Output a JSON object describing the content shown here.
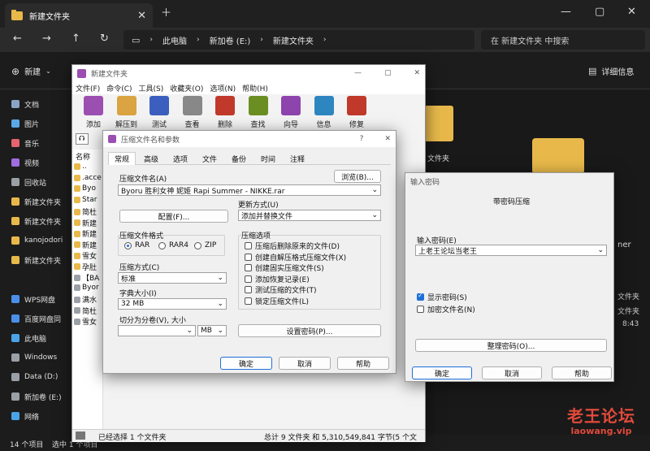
{
  "explorer": {
    "tab_title": "新建文件夹",
    "breadcrumb": [
      "此电脑",
      "新加卷 (E:)",
      "新建文件夹"
    ],
    "search_placeholder": "在 新建文件夹 中搜索",
    "new_label": "新建",
    "details_label": "详细信息",
    "sidebar": [
      {
        "label": "文档",
        "color": "#8aa4c8"
      },
      {
        "label": "图片",
        "color": "#5aa9e6"
      },
      {
        "label": "音乐",
        "color": "#e5646e"
      },
      {
        "label": "视频",
        "color": "#a06de0"
      },
      {
        "label": "回收站",
        "color": "#9aa0a6"
      },
      {
        "label": "新建文件夹",
        "color": "#e8b94a"
      },
      {
        "label": "新建文件夹",
        "color": "#e8b94a"
      },
      {
        "label": "kanojodori",
        "color": "#e8b94a"
      },
      {
        "label": "新建文件夹",
        "color": "#e8b94a"
      },
      {
        "label": "WPS网盘",
        "color": "#4a8fe8"
      },
      {
        "label": "百度网盘同",
        "color": "#4a8fe8"
      },
      {
        "label": "此电脑",
        "color": "#4aa3e8"
      },
      {
        "label": "Windows",
        "color": "#9aa0a6"
      },
      {
        "label": "Data (D:)",
        "color": "#9aa0a6"
      },
      {
        "label": "新加卷 (E:)",
        "color": "#9aa0a6"
      },
      {
        "label": "网络",
        "color": "#4aa3e8"
      }
    ],
    "right_texts": [
      "文件夹",
      "ner",
      "文件夹",
      "文件夹",
      "8:43"
    ],
    "status_left": "14 个项目",
    "status_mid": "选中 1 个项目"
  },
  "winrar": {
    "title": "新建文件夹",
    "menu": [
      "文件(F)",
      "命令(C)",
      "工具(S)",
      "收藏夹(O)",
      "选项(N)",
      "帮助(H)"
    ],
    "toolbar": [
      {
        "label": "添加",
        "color": "#9b4fb0"
      },
      {
        "label": "解压到",
        "color": "#d9a441"
      },
      {
        "label": "测试",
        "color": "#3c5fbf"
      },
      {
        "label": "查看",
        "color": "#888888"
      },
      {
        "label": "删除",
        "color": "#c0392b"
      },
      {
        "label": "查找",
        "color": "#6b8e23"
      },
      {
        "label": "向导",
        "color": "#8e44ad"
      },
      {
        "label": "信息",
        "color": "#2e86c1"
      },
      {
        "label": "修复",
        "color": "#c0392b"
      }
    ],
    "name_header": "名称",
    "files": [
      "..",
      ".acce",
      "Byo",
      "Star",
      "简杜",
      "新建",
      "新建",
      "新建",
      "雪女",
      "孕肚",
      "【BA",
      "Byor",
      "满水",
      "简杜",
      "雪女"
    ],
    "status": "已经选择 1 个文件夹",
    "status_total": "总计 9 文件夹 和 5,310,549,841 字节(5 个文"
  },
  "archive_dialog": {
    "title": "压缩文件名和参数",
    "question": "?",
    "tabs": [
      "常规",
      "高级",
      "选项",
      "文件",
      "备份",
      "时间",
      "注释"
    ],
    "archive_name_label": "压缩文件名(A)",
    "browse": "浏览(B)...",
    "archive_name": "Byoru 胜利女神 妮姬 Rapi Summer - NIKKE.rar",
    "update_label": "更新方式(U)",
    "update_value": "添加并替换文件",
    "profile": "配置(F)...",
    "format_label": "压缩文件格式",
    "formats": [
      {
        "label": "RAR",
        "on": true
      },
      {
        "label": "RAR4",
        "on": false
      },
      {
        "label": "ZIP",
        "on": false
      }
    ],
    "options_label": "压缩选项",
    "options": [
      "压缩后删除原来的文件(D)",
      "创建自解压格式压缩文件(X)",
      "创建固实压缩文件(S)",
      "添加恢复记录(E)",
      "测试压缩的文件(T)",
      "锁定压缩文件(L)"
    ],
    "method_label": "压缩方式(C)",
    "method_value": "标准",
    "dict_label": "字典大小(I)",
    "dict_value": "32 MB",
    "split_label": "切分为分卷(V), 大小",
    "split_unit": "MB",
    "set_password": "设置密码(P)...",
    "ok": "确定",
    "cancel": "取消",
    "help": "帮助"
  },
  "password_dialog": {
    "title": "输入密码",
    "heading": "带密码压缩",
    "enter_label": "输入密码(E)",
    "password": "上老王论坛当老王",
    "show_password": "显示密码(S)",
    "show_checked": true,
    "encrypt_names": "加密文件名(N)",
    "encrypt_checked": false,
    "organize": "整理密码(O)...",
    "ok": "确定",
    "cancel": "取消",
    "help": "帮助"
  },
  "watermark": {
    "title": "老王论坛",
    "url": "laowang.vip",
    "color": "#e24a3b"
  }
}
